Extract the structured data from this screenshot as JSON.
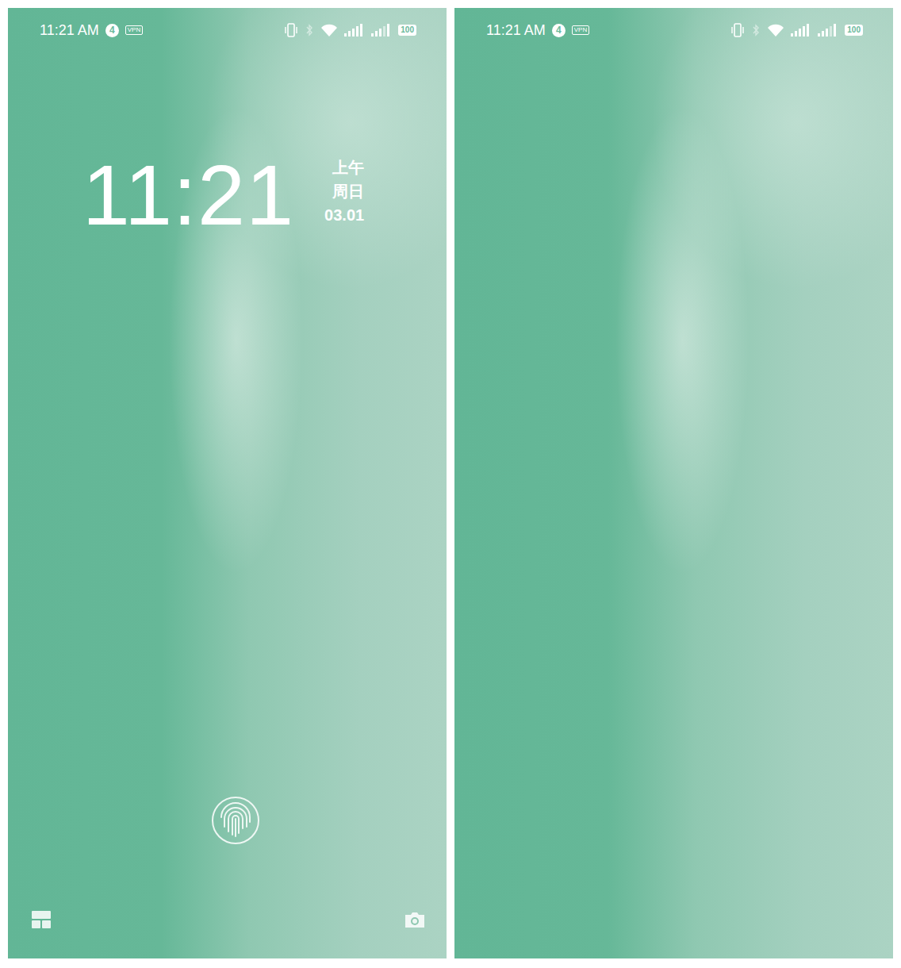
{
  "screens": [
    {
      "kind": "lockscreen",
      "status_bar": {
        "time": "11:21 AM",
        "notification_count": "4",
        "vpn": "VPN",
        "battery": "100"
      },
      "clock": {
        "time": "11:21",
        "period": "上午",
        "weekday": "周日",
        "date": "03.01"
      }
    },
    {
      "kind": "clean",
      "status_bar": {
        "time": "11:21 AM",
        "notification_count": "4",
        "vpn": "VPN",
        "battery": "100"
      }
    }
  ]
}
